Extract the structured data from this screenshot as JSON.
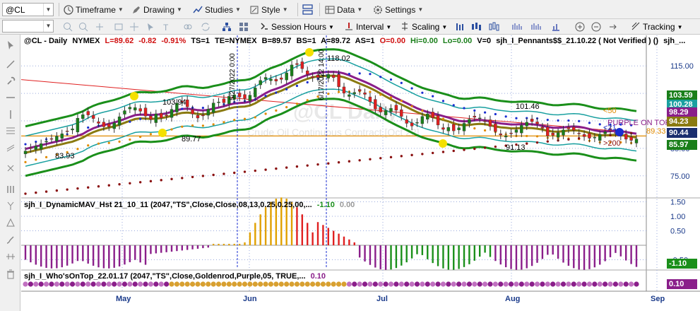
{
  "toolbar": {
    "symbol": "@CL",
    "timeframe_label": "Timeframe",
    "drawing_label": "Drawing",
    "studies_label": "Studies",
    "style_label": "Style",
    "data_label": "Data",
    "settings_label": "Settings"
  },
  "toolbar2": {
    "input_value": "",
    "session_label": "Session Hours",
    "interval_label": "Interval",
    "scaling_label": "Scaling",
    "tracking_label": "Tracking"
  },
  "chart_header": {
    "symbol": "@CL - Daily",
    "exchange": "NYMEX",
    "last": "L=89.62",
    "change": "-0.82",
    "pct": "-0.91%",
    "ts": "TS=1",
    "te": "TE=NYMEX",
    "bid": "B=89.57",
    "bs": "BS=1",
    "ask": "A=89.72",
    "as": "AS=1",
    "open": "O=0.00",
    "hi": "Hi=0.00",
    "lo": "Lo=0.00",
    "vol": "V=0",
    "study": "sjh_I_Pennants$$_21.10.22 ( Not Verified ) ()",
    "study2": "sjh_..."
  },
  "chart_annotations": {
    "watermark": "@CL Daily",
    "watermark_sub": "Crude Oil Continuous Contract [Oct 22]",
    "high_label": "118.02",
    "label_10394": "103.94",
    "label_9977": "89.77",
    "label_8393": "83.93",
    "label_10146": "101.46",
    "label_9113": "91.13",
    "vline1_date": "5/27/2022 0:00",
    "vline2_date": "6/17/2022 14:00",
    "ma50": "<50",
    "ma21": "<21",
    "ma200": ">200",
    "purple_on_top": "PURPLE ON TOP",
    "pennant_value": "89.33"
  },
  "price_axis": {
    "ticks": [
      "115.00",
      "105.00",
      "95.00",
      "85.00",
      "75.00"
    ],
    "tags": [
      {
        "label": "103.59",
        "color": "#1a7f1a"
      },
      {
        "label": "100.28",
        "color": "#1aa0a0"
      },
      {
        "label": "98.29",
        "color": "#8a1e8a"
      },
      {
        "label": "94.23",
        "color": "#8a7a10"
      },
      {
        "label": "90.44",
        "color": "#1a2e6e"
      },
      {
        "label": "85.97",
        "color": "#1a7f1a"
      }
    ]
  },
  "indicator1": {
    "title": "sjh_I_DynamicMAV_Hst 21_10_11 (2047,\"TS\",Close,Close,08,13,0.25,0.25,00,...",
    "value1": "-1.10",
    "value2": "0.00",
    "ticks": [
      "1.50",
      "1.00",
      "0.50",
      "-0.50"
    ],
    "last_tag": "-1.10"
  },
  "indicator2": {
    "title": "sjh_I_Who'sOnTop_22.01.17 (2047,\"TS\",Close,Goldenrod,Purple,05, TRUE,...",
    "value": "0.10",
    "last_tag": "0.10"
  },
  "time_axis": {
    "labels": [
      "May",
      "Jun",
      "Jul",
      "Aug",
      "Sep"
    ]
  },
  "colors": {
    "up_candle": "#1a7f1a",
    "down_candle": "#e02020",
    "band": "#1a8f1a",
    "teal": "#1aa0a0",
    "purple": "#8a1e8a",
    "olive": "#8a7a10",
    "blue_dots": "#1a2ed0",
    "orange_dots": "#e08a00",
    "maroon_dots": "#8a1010",
    "histo_up": "#e0a000",
    "histo_up2": "#e02020",
    "histo_down": "#8a1e8a",
    "histo_down2": "#1a8f1a"
  },
  "chart_data": {
    "type": "line",
    "title": "@CL - Daily NYMEX",
    "x_labels": [
      "May",
      "Jun",
      "Jul",
      "Aug",
      "Sep"
    ],
    "price_ticks": [
      115,
      105,
      95,
      85,
      75
    ],
    "ylim": [
      68,
      122
    ],
    "highlighted_values": [
      118.02,
      103.94,
      89.77,
      83.93,
      101.46,
      91.13
    ],
    "last_values": {
      "band_upper": 103.59,
      "teal": 100.28,
      "purple": 98.29,
      "olive": 94.23,
      "blue": 90.44,
      "band_lower": 85.97,
      "pennant": 89.33
    }
  }
}
